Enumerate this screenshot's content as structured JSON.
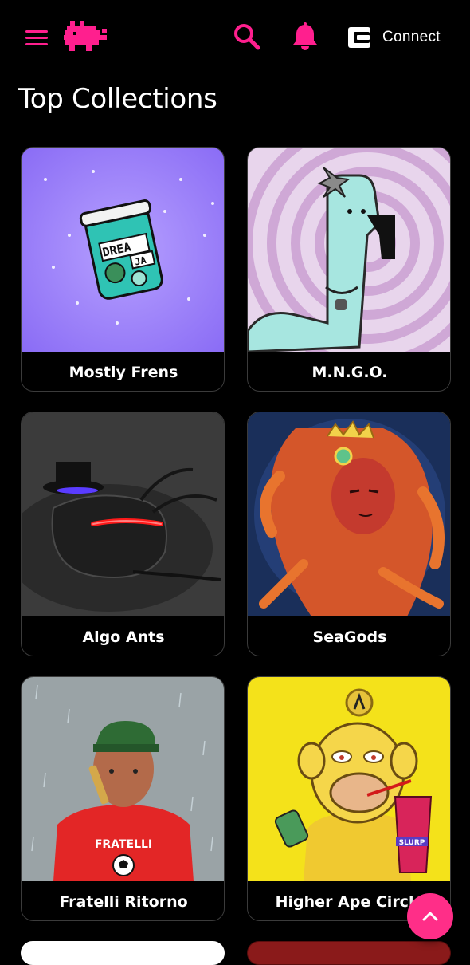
{
  "header": {
    "menu_icon": "hamburger-menu-icon",
    "logo_icon": "pixel-pig-logo",
    "search_icon": "search-icon",
    "notification_icon": "bell-icon",
    "connect_icon": "wallet-icon",
    "connect_label": "Connect",
    "accent_color": "#ff1f8e"
  },
  "page": {
    "title": "Top Collections"
  },
  "collections": [
    {
      "name": "Mostly Frens"
    },
    {
      "name": "M.N.G.O."
    },
    {
      "name": "Algo Ants"
    },
    {
      "name": "SeaGods"
    },
    {
      "name": "Fratelli Ritorno"
    },
    {
      "name": "Higher Ape Circle"
    }
  ],
  "artwork_text": {
    "jar_label_top": "DREA",
    "jar_label_bottom": "JA",
    "jersey_text": "FRATELLI",
    "cup_text": "SLURP"
  },
  "scroll_top_button": {
    "icon": "chevron-up-icon",
    "color": "#ff2e88"
  }
}
